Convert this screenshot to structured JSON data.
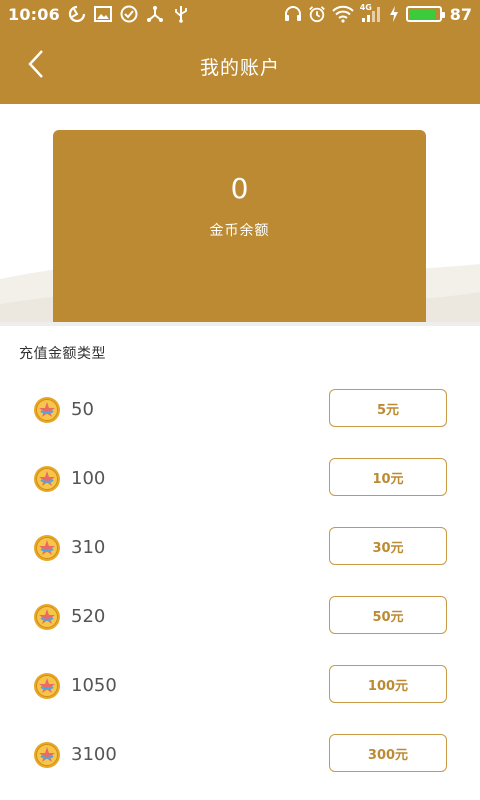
{
  "status_bar": {
    "time": "10:06",
    "battery": "87",
    "battery_level": 0.87,
    "network": "4G",
    "left_icons": [
      "sync-icon",
      "image-icon",
      "check-circle-icon",
      "share-node-icon",
      "usb-icon"
    ],
    "right_icons": [
      "headphones-icon",
      "alarm-icon",
      "wifi-icon",
      "signal-icon",
      "charging-icon"
    ]
  },
  "header": {
    "title": "我的账户",
    "back_icon": "chevron-left-icon"
  },
  "balance": {
    "value": "0",
    "label": "金币余额"
  },
  "section": {
    "title": "充值金额类型"
  },
  "options": [
    {
      "coins": "50",
      "price": "5元"
    },
    {
      "coins": "100",
      "price": "10元"
    },
    {
      "coins": "310",
      "price": "30元"
    },
    {
      "coins": "520",
      "price": "50元"
    },
    {
      "coins": "1050",
      "price": "100元"
    },
    {
      "coins": "3100",
      "price": "300元"
    }
  ],
  "colors": {
    "brand": "#BC8A32",
    "button_border": "#C99A45",
    "battery_fill": "#3CCB3C",
    "coin_gold": "#E8A826"
  }
}
